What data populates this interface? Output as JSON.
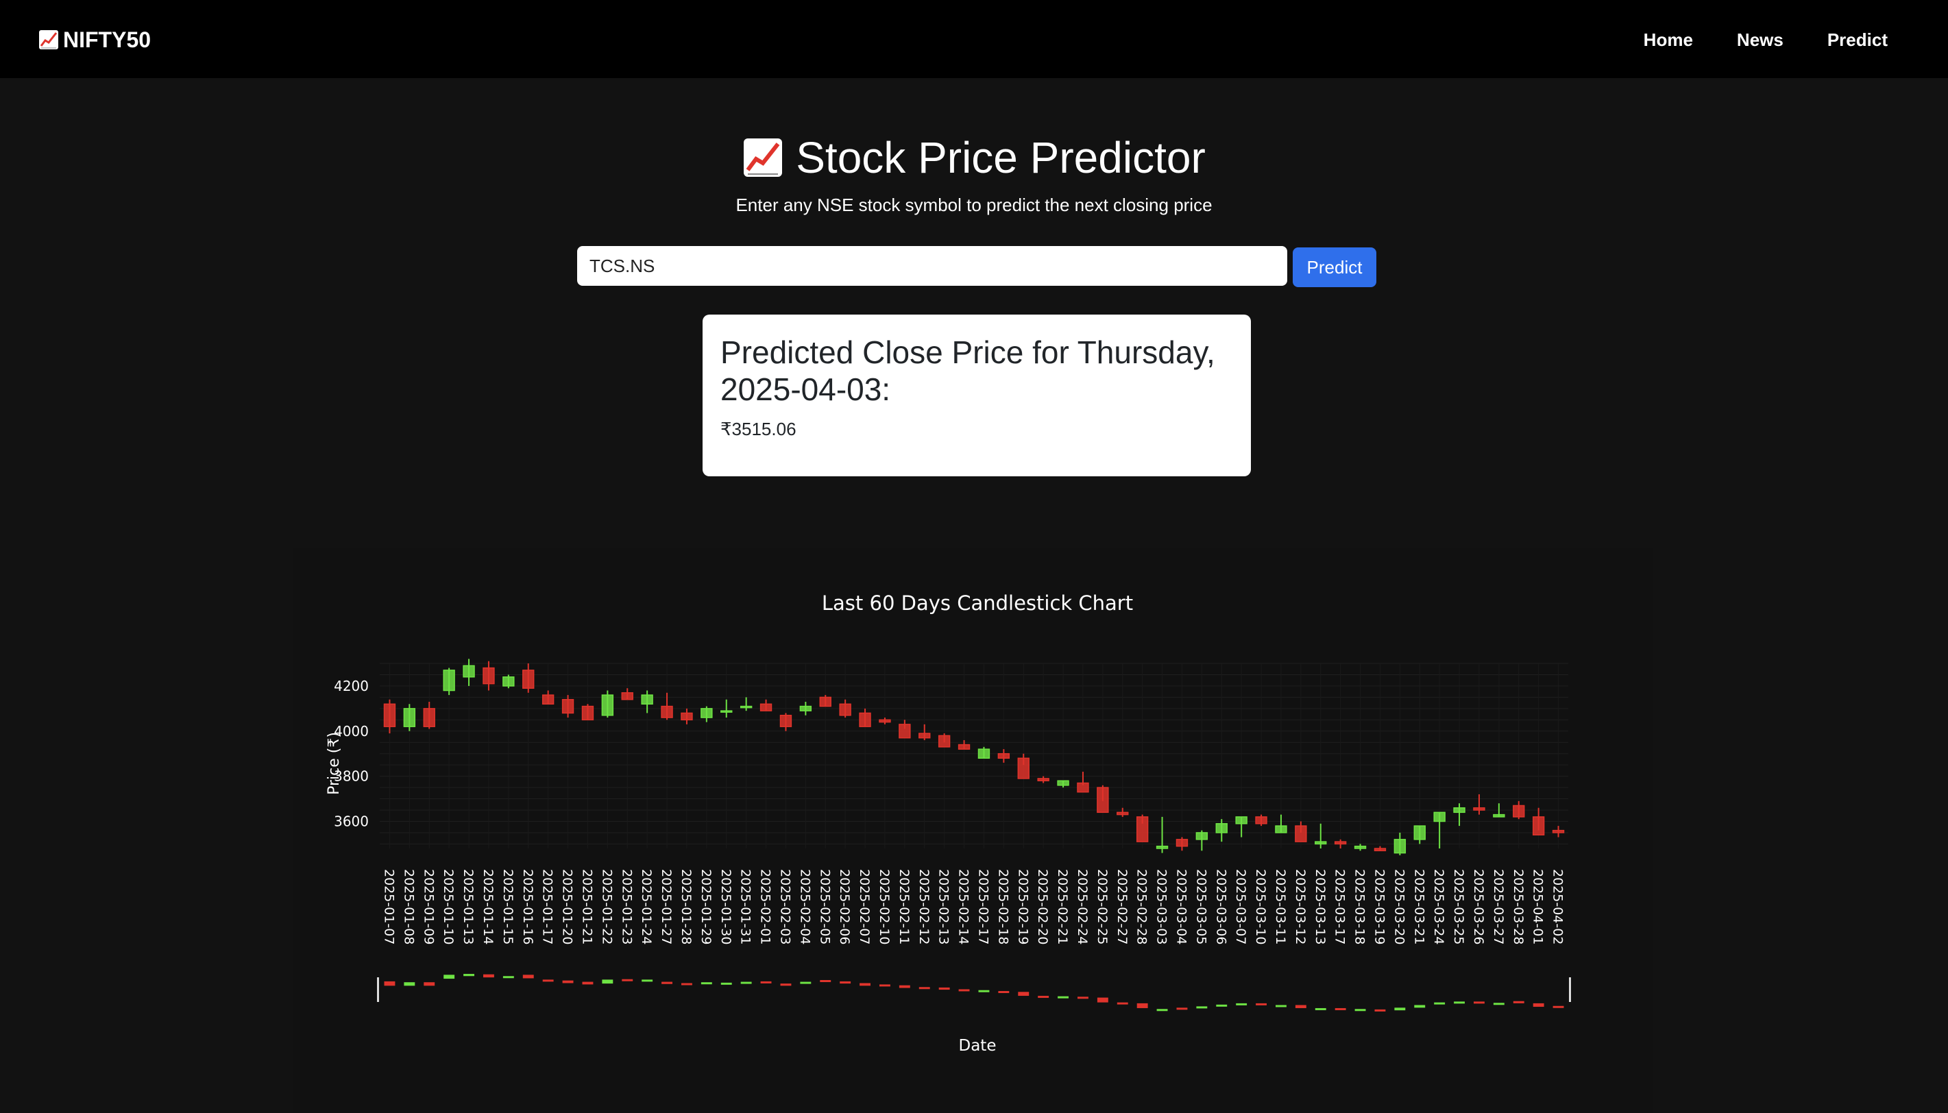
{
  "navbar": {
    "brand": "NIFTY50",
    "links": [
      "Home",
      "News",
      "Predict"
    ]
  },
  "header": {
    "title": "Stock Price Predictor",
    "subtitle": "Enter any NSE stock symbol to predict the next closing price"
  },
  "search": {
    "value": "TCS.NS",
    "button_label": "Predict"
  },
  "result": {
    "heading": "Predicted Close Price for Thursday, 2025-04-03:",
    "value": "₹3515.06"
  },
  "colors": {
    "up": "#6ee344",
    "down": "#e0342c",
    "accent": "#2f6feb",
    "navbar": "#000000",
    "background": "#121212"
  },
  "icons": {
    "brand": "chart-increasing-icon",
    "title": "chart-increasing-icon"
  },
  "chart_data": {
    "type": "candlestick",
    "title": "Last 60 Days Candlestick Chart",
    "xlabel": "Date",
    "ylabel": "Price (₹)",
    "ylim": [
      3480,
      4300
    ],
    "yticks": [
      3600,
      3800,
      4000,
      4200
    ],
    "grid": true,
    "rangeslider": true,
    "dates": [
      "2025-01-07",
      "2025-01-08",
      "2025-01-09",
      "2025-01-10",
      "2025-01-13",
      "2025-01-14",
      "2025-01-15",
      "2025-01-16",
      "2025-01-17",
      "2025-01-20",
      "2025-01-21",
      "2025-01-22",
      "2025-01-23",
      "2025-01-24",
      "2025-01-27",
      "2025-01-28",
      "2025-01-29",
      "2025-01-30",
      "2025-01-31",
      "2025-02-01",
      "2025-02-03",
      "2025-02-04",
      "2025-02-05",
      "2025-02-06",
      "2025-02-07",
      "2025-02-10",
      "2025-02-11",
      "2025-02-12",
      "2025-02-13",
      "2025-02-14",
      "2025-02-17",
      "2025-02-18",
      "2025-02-19",
      "2025-02-20",
      "2025-02-21",
      "2025-02-24",
      "2025-02-25",
      "2025-02-27",
      "2025-02-28",
      "2025-03-03",
      "2025-03-04",
      "2025-03-05",
      "2025-03-06",
      "2025-03-07",
      "2025-03-10",
      "2025-03-11",
      "2025-03-12",
      "2025-03-13",
      "2025-03-17",
      "2025-03-18",
      "2025-03-19",
      "2025-03-20",
      "2025-03-21",
      "2025-03-24",
      "2025-03-25",
      "2025-03-26",
      "2025-03-27",
      "2025-03-28",
      "2025-04-01",
      "2025-04-02"
    ],
    "open": [
      4120,
      4020,
      4100,
      4180,
      4240,
      4280,
      4200,
      4270,
      4160,
      4140,
      4110,
      4070,
      4170,
      4120,
      4110,
      4080,
      4060,
      4090,
      4110,
      4120,
      4070,
      4090,
      4150,
      4120,
      4080,
      4050,
      4030,
      3990,
      3980,
      3940,
      3880,
      3900,
      3880,
      3790,
      3760,
      3770,
      3750,
      3640,
      3620,
      3480,
      3520,
      3520,
      3550,
      3590,
      3620,
      3550,
      3580,
      3500,
      3510,
      3480,
      3480,
      3460,
      3520,
      3600,
      3640,
      3660,
      3620,
      3670,
      3620,
      3560
    ],
    "high": [
      4140,
      4120,
      4130,
      4280,
      4320,
      4310,
      4250,
      4300,
      4180,
      4160,
      4120,
      4180,
      4190,
      4180,
      4170,
      4100,
      4110,
      4140,
      4150,
      4140,
      4080,
      4130,
      4160,
      4140,
      4100,
      4060,
      4050,
      4030,
      3990,
      3960,
      3930,
      3920,
      3900,
      3800,
      3780,
      3820,
      3760,
      3660,
      3630,
      3620,
      3530,
      3560,
      3610,
      3620,
      3630,
      3630,
      3600,
      3590,
      3520,
      3500,
      3490,
      3550,
      3580,
      3640,
      3680,
      3720,
      3680,
      3690,
      3660,
      3580
    ],
    "low": [
      3990,
      4000,
      4010,
      4160,
      4200,
      4180,
      4190,
      4170,
      4120,
      4060,
      4050,
      4060,
      4140,
      4080,
      4050,
      4030,
      4040,
      4060,
      4090,
      4090,
      4000,
      4070,
      4110,
      4060,
      4020,
      4030,
      4010,
      3960,
      3950,
      3920,
      3880,
      3860,
      3850,
      3770,
      3750,
      3760,
      3690,
      3620,
      3590,
      3460,
      3470,
      3470,
      3510,
      3530,
      3580,
      3550,
      3550,
      3480,
      3480,
      3470,
      3470,
      3450,
      3500,
      3480,
      3580,
      3630,
      3620,
      3610,
      3560,
      3530
    ],
    "close": [
      4020,
      4100,
      4020,
      4270,
      4290,
      4210,
      4240,
      4190,
      4120,
      4080,
      4050,
      4160,
      4140,
      4160,
      4060,
      4050,
      4100,
      4090,
      4110,
      4090,
      4020,
      4110,
      4110,
      4070,
      4020,
      4040,
      3970,
      3970,
      3930,
      3920,
      3920,
      3880,
      3790,
      3780,
      3780,
      3730,
      3640,
      3630,
      3510,
      3490,
      3490,
      3550,
      3590,
      3620,
      3590,
      3580,
      3510,
      3510,
      3500,
      3490,
      3470,
      3520,
      3580,
      3640,
      3660,
      3650,
      3630,
      3620,
      3540,
      3550
    ]
  }
}
